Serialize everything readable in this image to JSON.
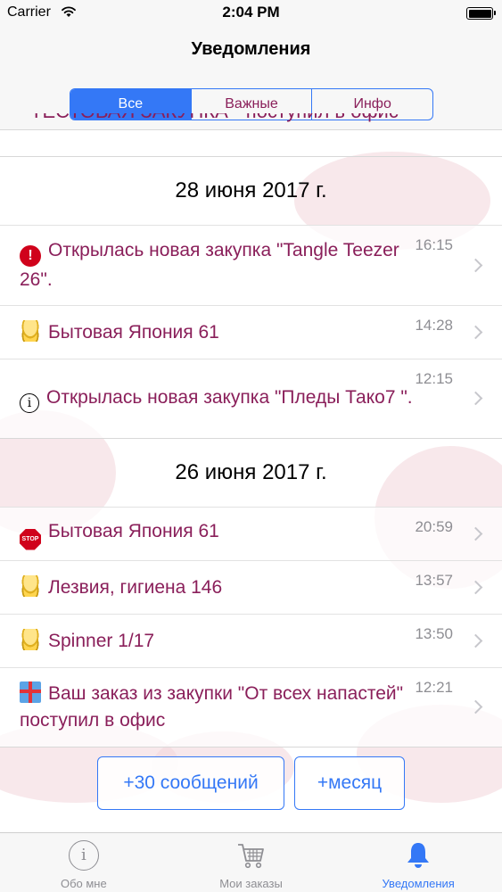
{
  "status_bar": {
    "carrier": "Carrier",
    "time": "2:04 PM",
    "wifi_icon": "wifi-icon",
    "battery_icon": "battery-icon"
  },
  "nav": {
    "title": "Уведомления",
    "segments": [
      {
        "label": "Все",
        "selected": true
      },
      {
        "label": "Важные",
        "selected": false
      },
      {
        "label": "Инфо",
        "selected": false
      }
    ],
    "partial_row_text": "ТЕСТОВАЯ ЗАКУПКА \" поступил в офис"
  },
  "sections": [
    {
      "date": "28 июня 2017 г.",
      "items": [
        {
          "icon": "alert-icon",
          "text": "Открылась новая закупка \"Tangle Teezer 26\".",
          "time": "16:15"
        },
        {
          "icon": "coins-icon",
          "text": "Бытовая Япония 61",
          "time": "14:28"
        },
        {
          "icon": "info-icon",
          "text": "Открылась новая закупка \"Пледы Тако7 \".",
          "time": "12:15"
        }
      ]
    },
    {
      "date": "26 июня 2017 г.",
      "items": [
        {
          "icon": "stop-sign-icon",
          "text": "Бытовая Япония 61",
          "time": "20:59",
          "icon_text": "STOP"
        },
        {
          "icon": "coins-icon",
          "text": "Лезвия, гигиена 146",
          "time": "13:57"
        },
        {
          "icon": "coins-icon",
          "text": "Spinner 1/17",
          "time": "13:50"
        },
        {
          "icon": "gift-icon",
          "text": "Ваш заказ из закупки \"От всех напастей\" поступил в офис",
          "time": "12:21"
        }
      ]
    }
  ],
  "buttons": {
    "more_messages": "+30 сообщений",
    "more_month": "+месяц"
  },
  "tab_bar": {
    "tabs": [
      {
        "label": "Обо мне",
        "icon": "info-circle-icon",
        "active": false
      },
      {
        "label": "Мои заказы",
        "icon": "cart-icon",
        "active": false
      },
      {
        "label": "Уведомления",
        "icon": "bell-icon",
        "active": true
      }
    ]
  },
  "colors": {
    "accent": "#3478f6",
    "item_text": "#8a1f5a",
    "time_text": "#8e8e93"
  }
}
